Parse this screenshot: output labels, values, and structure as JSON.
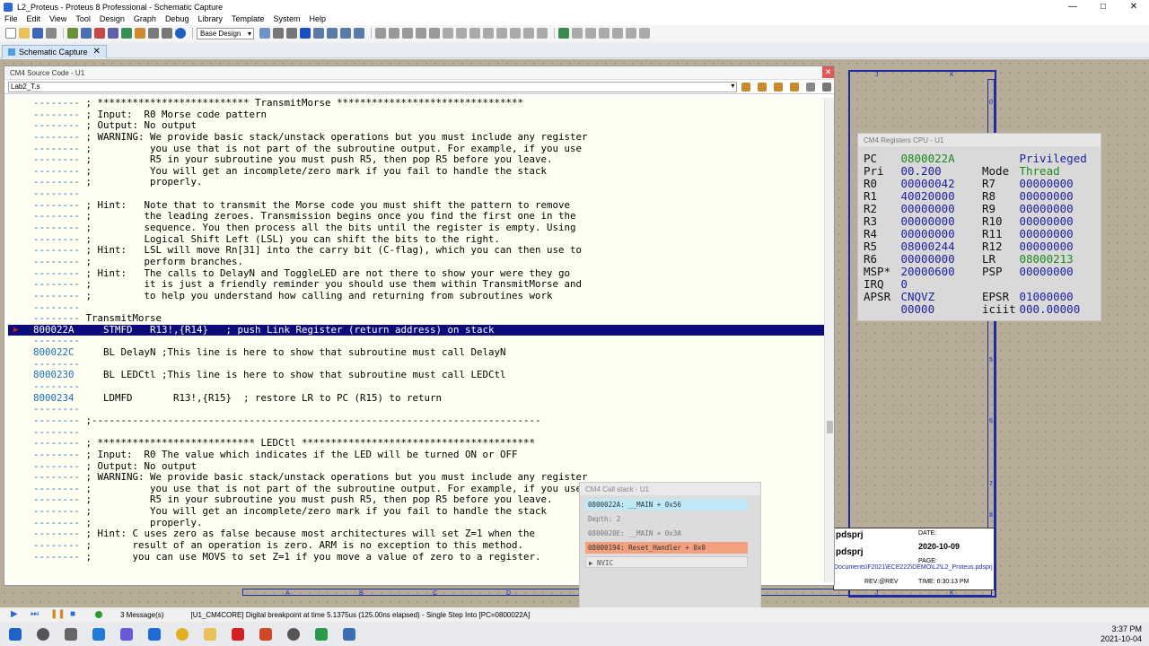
{
  "window": {
    "title": "L2_Proteus - Proteus 8 Professional - Schematic Capture",
    "controls": [
      "—",
      "□",
      "✕"
    ]
  },
  "menu": [
    "File",
    "Edit",
    "View",
    "Tool",
    "Design",
    "Graph",
    "Debug",
    "Library",
    "Template",
    "System",
    "Help"
  ],
  "toolbar": {
    "design_combo": "Base Design"
  },
  "tab": {
    "label": "Schematic Capture",
    "close": "✕"
  },
  "source": {
    "title": "CM4 Source Code - U1",
    "file": "Lab2_T.s",
    "lines": [
      {
        "addr": "--------",
        "text": " ; ************************** TransmitMorse ********************************"
      },
      {
        "addr": "--------",
        "text": " ; Input:  R0 Morse code pattern"
      },
      {
        "addr": "--------",
        "text": " ; Output: No output"
      },
      {
        "addr": "--------",
        "text": " ; WARNING: We provide basic stack/unstack operations but you must include any register"
      },
      {
        "addr": "--------",
        "text": " ;          you use that is not part of the subroutine output. For example, if you use"
      },
      {
        "addr": "--------",
        "text": " ;          R5 in your subroutine you must push R5, then pop R5 before you leave."
      },
      {
        "addr": "--------",
        "text": " ;          You will get an incomplete/zero mark if you fail to handle the stack"
      },
      {
        "addr": "--------",
        "text": " ;          properly."
      },
      {
        "addr": "--------",
        "text": ""
      },
      {
        "addr": "--------",
        "text": " ; Hint:   Note that to transmit the Morse code you must shift the pattern to remove"
      },
      {
        "addr": "--------",
        "text": " ;         the leading zeroes. Transmission begins once you find the first one in the"
      },
      {
        "addr": "--------",
        "text": " ;         sequence. You then process all the bits until the register is empty. Using"
      },
      {
        "addr": "--------",
        "text": " ;         Logical Shift Left (LSL) you can shift the bits to the right."
      },
      {
        "addr": "--------",
        "text": " ; Hint:   LSL will move Rn[31] into the carry bit (C-flag), which you can then use to"
      },
      {
        "addr": "--------",
        "text": " ;         perform branches."
      },
      {
        "addr": "--------",
        "text": " ; Hint:   The calls to DelayN and ToggleLED are not there to show your were they go"
      },
      {
        "addr": "--------",
        "text": " ;         it is just a friendly reminder you should use them within TransmitMorse and"
      },
      {
        "addr": "--------",
        "text": " ;         to help you understand how calling and returning from subroutines work"
      },
      {
        "addr": "--------",
        "text": ""
      },
      {
        "addr": "--------",
        "text": " TransmitMorse"
      },
      {
        "addr": "800022A",
        "text": "     STMFD   R13!,{R14}   ; push Link Register (return address) on stack",
        "exec": true
      },
      {
        "addr": "--------",
        "text": ""
      },
      {
        "addr": "800022C",
        "text": "     BL DelayN ;This line is here to show that subroutine must call DelayN"
      },
      {
        "addr": "--------",
        "text": ""
      },
      {
        "addr": "8000230",
        "text": "     BL LEDCtl ;This line is here to show that subroutine must call LEDCtl"
      },
      {
        "addr": "--------",
        "text": ""
      },
      {
        "addr": "8000234",
        "text": "     LDMFD       R13!,{R15}  ; restore LR to PC (R15) to return"
      },
      {
        "addr": "--------",
        "text": ""
      },
      {
        "addr": "--------",
        "text": " ;-----------------------------------------------------------------------------"
      },
      {
        "addr": "--------",
        "text": ""
      },
      {
        "addr": "--------",
        "text": " ; *************************** LEDCtl ****************************************"
      },
      {
        "addr": "--------",
        "text": " ; Input:  R0 The value which indicates if the LED will be turned ON or OFF"
      },
      {
        "addr": "--------",
        "text": " ; Output: No output"
      },
      {
        "addr": "--------",
        "text": " ; WARNING: We provide basic stack/unstack operations but you must include any register"
      },
      {
        "addr": "--------",
        "text": " ;          you use that is not part of the subroutine output. For example, if you use"
      },
      {
        "addr": "--------",
        "text": " ;          R5 in your subroutine you must push R5, then pop R5 before you leave."
      },
      {
        "addr": "--------",
        "text": " ;          You will get an incomplete/zero mark if you fail to handle the stack"
      },
      {
        "addr": "--------",
        "text": " ;          properly."
      },
      {
        "addr": "--------",
        "text": " ; Hint: C uses zero as false because most architectures will set Z=1 when the"
      },
      {
        "addr": "--------",
        "text": " ;       result of an operation is zero. ARM is no exception to this method."
      },
      {
        "addr": "--------",
        "text": " ;       you can use MOVS to set Z=1 if you move a value of zero to a register."
      }
    ]
  },
  "registers": {
    "title": "CM4 Registers CPU - U1",
    "rows": [
      {
        "l": "PC",
        "lv": "0800022A",
        "r": "",
        "rv": "Privileged",
        "lgreen": true
      },
      {
        "l": "Pri",
        "lv": "00.200",
        "r": "Mode",
        "rv": "Thread",
        "rgreen": true
      },
      {
        "l": "R0",
        "lv": "00000042",
        "r": "R7",
        "rv": "00000000"
      },
      {
        "l": "R1",
        "lv": "40020000",
        "r": "R8",
        "rv": "00000000"
      },
      {
        "l": "R2",
        "lv": "00000000",
        "r": "R9",
        "rv": "00000000"
      },
      {
        "l": "R3",
        "lv": "00000000",
        "r": "R10",
        "rv": "00000000"
      },
      {
        "l": "R4",
        "lv": "00000000",
        "r": "R11",
        "rv": "00000000"
      },
      {
        "l": "R5",
        "lv": "08000244",
        "r": "R12",
        "rv": "00000000"
      },
      {
        "l": "R6",
        "lv": "00000000",
        "r": "LR",
        "rv": "08000213",
        "rgreen": true
      },
      {
        "l": "MSP*",
        "lv": "20000600",
        "r": "PSP",
        "rv": "00000000"
      },
      {
        "l": "IRQ",
        "lv": "0",
        "r": "",
        "rv": ""
      },
      {
        "l": "APSR",
        "lv": "CNQVZ",
        "r": "EPSR",
        "rv": "01000000"
      },
      {
        "l": "",
        "lv": "00000",
        "r": "iciit",
        "rv": "000.00000"
      }
    ]
  },
  "callstack": {
    "title": "CM4 Call stack - U1",
    "items": [
      {
        "text": "0800022A: __MAIN + 0x56",
        "kind": "cur"
      },
      {
        "text": "Depth: 2",
        "kind": "dim"
      },
      {
        "text": "0800020E: __MAIN + 0x3A",
        "kind": "dim"
      },
      {
        "text": "08000194: Reset_Handler + 0x0",
        "kind": "red"
      },
      {
        "text": "▶ NVIC",
        "kind": "grp"
      }
    ]
  },
  "titleblock": {
    "name1": "pdsprj",
    "name2": "pdsprj",
    "date_label": "DATE:",
    "date": "2020-10-09",
    "path": "Documents\\F2021\\ECE222\\DEMO\\L2\\L2_Proteus.pdsprj",
    "page_label": "PAGE:",
    "rev": "REV:@REV",
    "time": "TIME: 6:30:13 PM"
  },
  "frame": {
    "top_labels": [
      "J",
      "K"
    ],
    "bottom_labels": [
      "A",
      "B",
      "C",
      "D",
      "E",
      "F",
      "G",
      "H",
      "I",
      "J",
      "K"
    ],
    "side_labels": [
      "0",
      "1",
      "2",
      "3",
      "4",
      "5",
      "6",
      "7",
      "8"
    ]
  },
  "status": {
    "messages": "3 Message(s)",
    "text": "[U1_CM4CORE] Digital breakpoint at time 5.1375us (125.00ns elapsed) - Single Step Into [PC=0800022A]"
  },
  "taskbar": {
    "time": "3:37 PM",
    "date": "2021-10-04"
  }
}
